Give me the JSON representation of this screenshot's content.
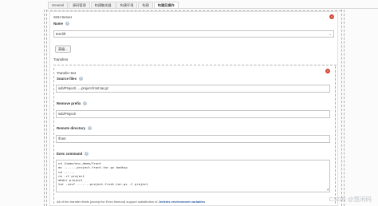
{
  "tabs": [
    {
      "label": "General",
      "active": false
    },
    {
      "label": "源码管理",
      "active": false
    },
    {
      "label": "构建触发器",
      "active": false
    },
    {
      "label": "构建环境",
      "active": false
    },
    {
      "label": "构建",
      "active": false
    },
    {
      "label": "构建后操作",
      "active": true
    }
  ],
  "ssh_server": {
    "section_title": "SSH Server",
    "name_label": "Name",
    "name_value": "test-lift",
    "advanced_button": "高级..."
  },
  "transfers": {
    "section_title": "Transfers",
    "transfer_set_title": "Transfer Set",
    "source_files_label": "Source files",
    "source_files_value": "sub/Project/......project-front.tar.gz",
    "remove_prefix_label": "Remove prefix",
    "remove_prefix_value": "sub/Project/",
    "remote_directory_label": "Remote directory",
    "remote_directory_value": "/front",
    "exec_command_label": "Exec command",
    "exec_command_lines": [
      "cd  /home/env_demo/front",
      "mv ......-project-front.tar.gz bodksp",
      "cd ......",
      "rm -rf project",
      "mkdir project",
      "tar -zxvf ......-project-front.tar.gz -C project"
    ],
    "note_text": "All of the transfer fields (except for Exec timeout) support substitution of",
    "note_link": "Jenkins environment variables"
  },
  "watermark": "CSDN @悠闲码"
}
